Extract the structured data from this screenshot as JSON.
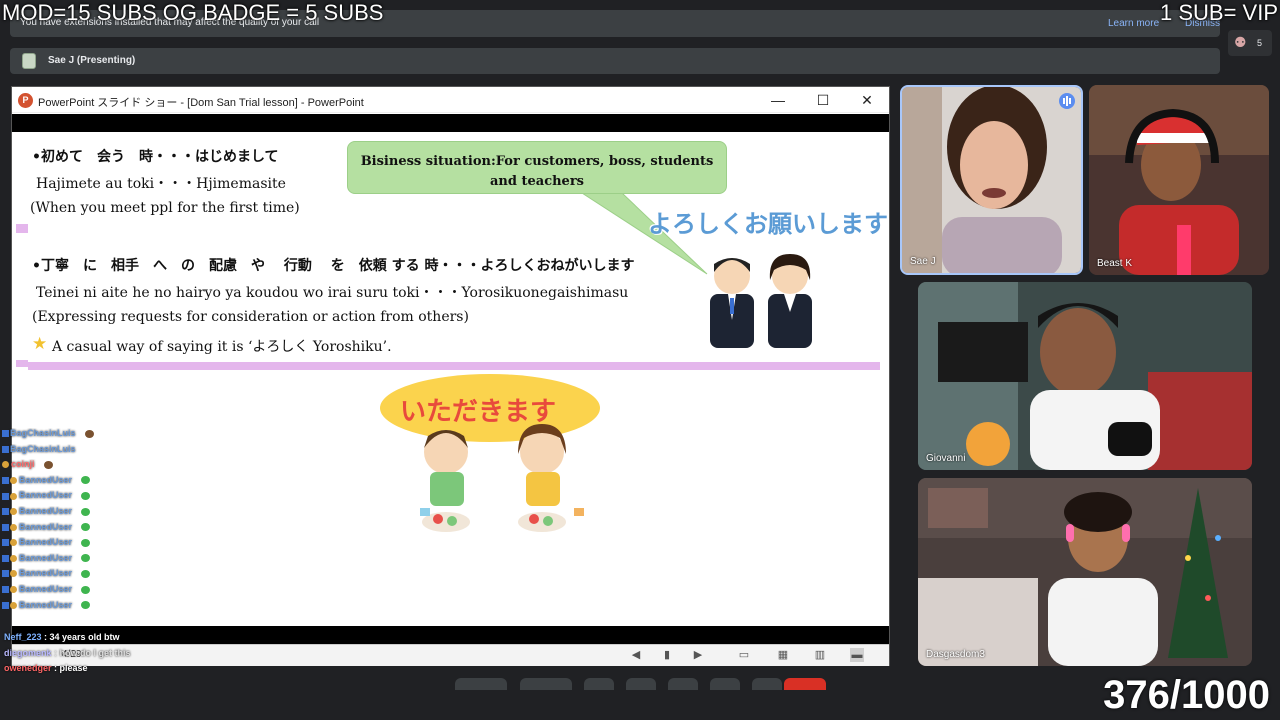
{
  "overlays": {
    "top_left": "MOD=15 SUBS    OG BADGE = 5 SUBS",
    "top_right": "1 SUB= VIP",
    "counter": "376/1000"
  },
  "banners": {
    "extension_message": "You have extensions installed that may affect the quality of your call",
    "learn_more": "Learn more",
    "dismiss": "Dismiss",
    "presenting": "Sae J (Presenting)",
    "people_count": "5"
  },
  "ppt": {
    "window_title": "PowerPoint スライド ショー - [Dom San Trial lesson] - PowerPoint",
    "logo_letter": "P",
    "minimize": "—",
    "maximize": "☐",
    "close": "✕",
    "page": "4/29"
  },
  "slide": {
    "line1": "•初めて　会う　時・・・はじめまして",
    "line2": "Hajimete  au  toki・・・Hjimemasite",
    "line3": "(When you meet ppl for the first time)",
    "line4": "•丁寧　に　相手　へ　の　配慮　や　 行動　 を　依頼 する 時・・・よろしくおねがいします",
    "line5": "Teinei ni  aite   he  no  hairyo ya koudou wo  irai  suru toki・・・Yorosikuonegaishimasu",
    "line6": "(Expressing requests for consideration or action from others)",
    "line7": "A casual way of saying it is ‘よろしく Yoroshiku’.",
    "star": "★",
    "bubble": "Bisiness situation:For customers, boss, students and teachers",
    "yoroshiku_art": "よろしくお願いします",
    "itadakimasu_art": "いただきます"
  },
  "chat": [
    {
      "user": "BagChasinLuis",
      "msg": ":",
      "emote": "brown"
    },
    {
      "user": "BagChasinLuis",
      "msg": ":",
      "emote": "face"
    },
    {
      "user": "coinji",
      "msg": ":",
      "emote": "brown"
    },
    {
      "user": "BannedUser",
      "msg": ":",
      "emote": "green"
    },
    {
      "user": "BannedUser",
      "msg": ":",
      "emote": "green"
    },
    {
      "user": "BannedUser",
      "msg": ":",
      "emote": "green"
    },
    {
      "user": "BannedUser",
      "msg": ":",
      "emote": "green"
    },
    {
      "user": "BannedUser",
      "msg": ":",
      "emote": "green"
    },
    {
      "user": "BannedUser",
      "msg": ":",
      "emote": "green"
    },
    {
      "user": "BannedUser",
      "msg": ":",
      "emote": "green"
    },
    {
      "user": "BannedUser",
      "msg": ":",
      "emote": "green"
    },
    {
      "user": "BannedUser",
      "msg": ":",
      "emote": "green"
    }
  ],
  "chat_wide": [
    {
      "user": "Neff_223",
      "msg": " : 34 years old btw"
    },
    {
      "user": "diegomenk",
      "msg": " : how do I get this"
    },
    {
      "user": "owenedger",
      "msg": " : please"
    }
  ],
  "participants": {
    "sae": "Sae J",
    "beast": "Beast K",
    "giovanni": "Giovanni",
    "dasgasdom": "Dasgasdom3"
  },
  "colors": {
    "accent_blue": "#8ab4f8",
    "speaking_border": "#a8c7fa",
    "ppt_orange": "#d35230",
    "bubble_green": "#b5e0a1",
    "pink_line": "#e4b6ec"
  }
}
